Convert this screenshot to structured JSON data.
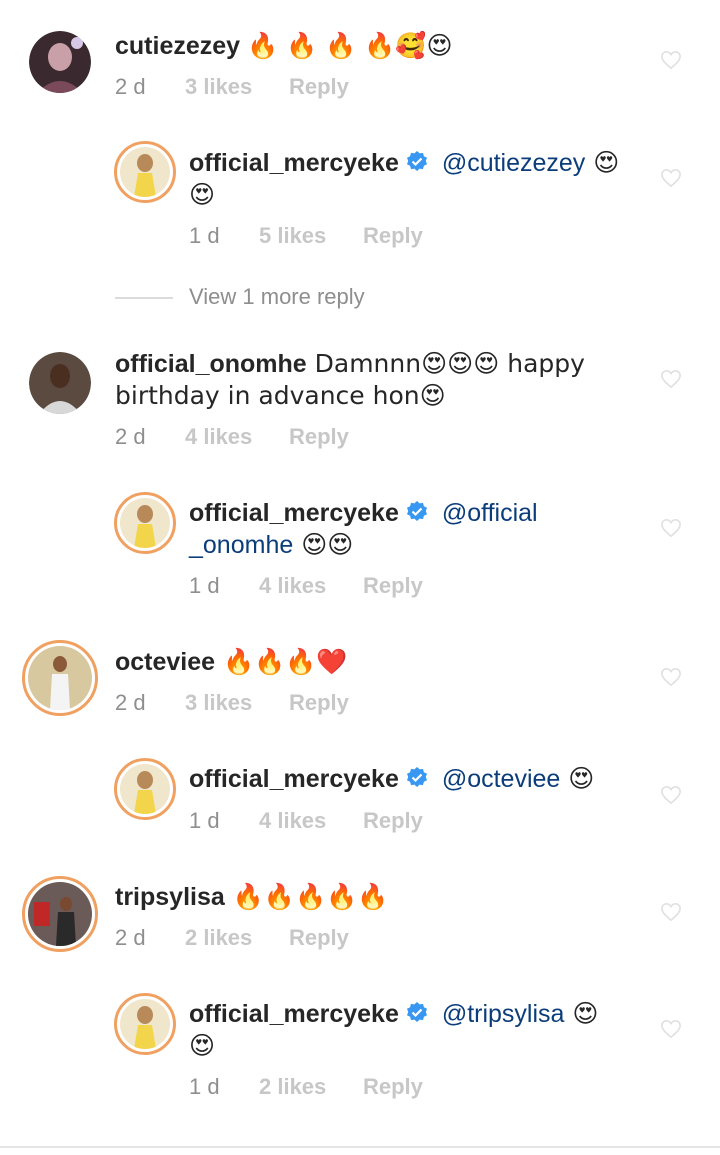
{
  "comments": [
    {
      "username": "cutiezezey",
      "text": "🔥 🔥 🔥 🔥🥰😍",
      "time": "2 d",
      "likes": "3 likes",
      "reply": "Reply"
    },
    {
      "username": "official_mercyeke",
      "mention": "@cutiezezey",
      "text": " 😍",
      "line2": "😍",
      "time": "1 d",
      "likes": "5 likes",
      "reply": "Reply"
    },
    {
      "view_more": "View 1 more reply"
    },
    {
      "username": "official_onomhe",
      "text": " Damnnn😍😍😍 happy",
      "line2": "birthday in advance hon😍",
      "time": "2 d",
      "likes": "4 likes",
      "reply": "Reply"
    },
    {
      "username": "official_mercyeke",
      "mention": "@official",
      "mention2": "_onomhe",
      "text": " 😍😍",
      "time": "1 d",
      "likes": "4 likes",
      "reply": "Reply"
    },
    {
      "username": "octeviee",
      "text": " 🔥🔥🔥❤️",
      "time": "2 d",
      "likes": "3 likes",
      "reply": "Reply"
    },
    {
      "username": "official_mercyeke",
      "mention": "@octeviee",
      "text": " 😍",
      "time": "1 d",
      "likes": "4 likes",
      "reply": "Reply"
    },
    {
      "username": "tripsylisa",
      "text": " 🔥🔥🔥🔥🔥",
      "time": "2 d",
      "likes": "2 likes",
      "reply": "Reply"
    },
    {
      "username": "official_mercyeke",
      "mention": "@tripsylisa",
      "text": " 😍",
      "line2": "😍",
      "time": "1 d",
      "likes": "2 likes",
      "reply": "Reply"
    }
  ],
  "icons": {
    "like": "heart-outline-icon",
    "verified": "verified-badge-icon"
  },
  "colors": {
    "mention": "#0b3d7a",
    "verified": "#3897f0",
    "muted": "#8e8e8e",
    "faint": "#c7c7c7"
  }
}
